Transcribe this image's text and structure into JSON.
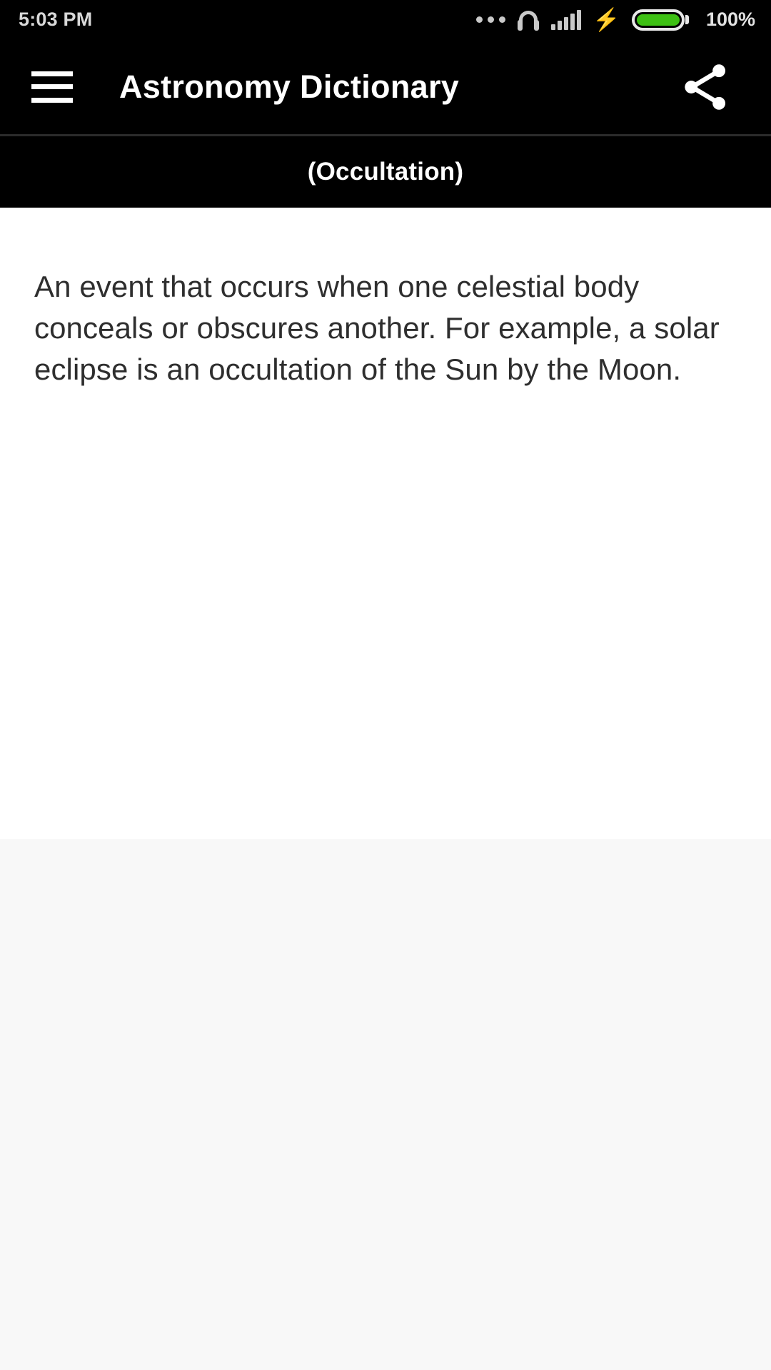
{
  "status_bar": {
    "time": "5:03 PM",
    "battery_percent": "100%",
    "battery_color": "#3dc013",
    "icons": [
      "more-dots-icon",
      "headphones-icon",
      "signal-bars-icon",
      "charging-bolt-icon",
      "battery-icon"
    ]
  },
  "app_bar": {
    "menu_icon": "hamburger-menu-icon",
    "title": "Astronomy Dictionary",
    "share_icon": "share-icon",
    "background": "#000000",
    "text_color": "#ffffff"
  },
  "subtitle_bar": {
    "term": "(Occultation)"
  },
  "content": {
    "definition": "An event that occurs when one celestial body conceals or obscures another. For example, a solar eclipse is an occultation of the Sun by the Moon."
  }
}
